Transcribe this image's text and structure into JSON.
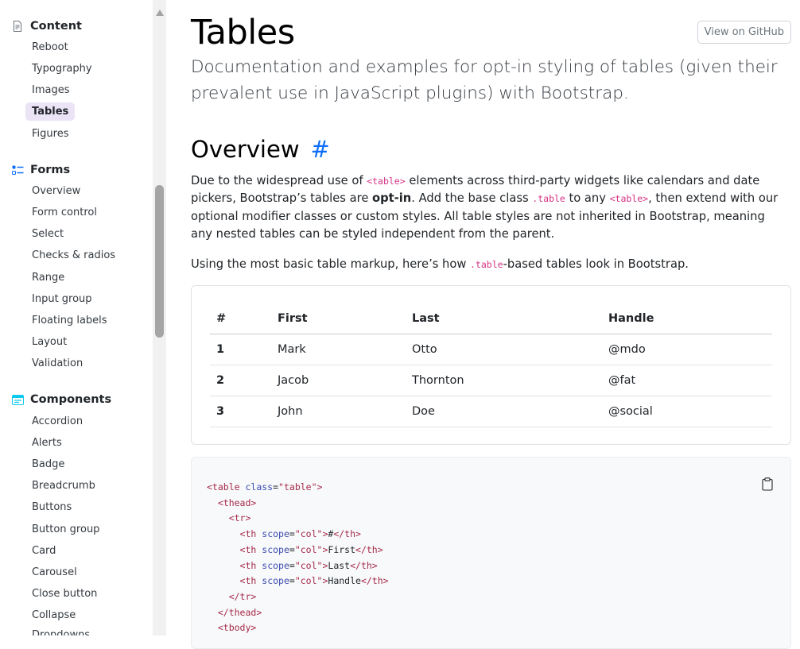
{
  "sidebar": {
    "groups": [
      {
        "title": "Content",
        "icon": "document-icon",
        "items": [
          "Reboot",
          "Typography",
          "Images",
          "Tables",
          "Figures"
        ],
        "active": "Tables"
      },
      {
        "title": "Forms",
        "icon": "ui-checks-icon",
        "items": [
          "Overview",
          "Form control",
          "Select",
          "Checks & radios",
          "Range",
          "Input group",
          "Floating labels",
          "Layout",
          "Validation"
        ]
      },
      {
        "title": "Components",
        "icon": "menu-button-icon",
        "items": [
          "Accordion",
          "Alerts",
          "Badge",
          "Breadcrumb",
          "Buttons",
          "Button group",
          "Card",
          "Carousel",
          "Close button",
          "Collapse",
          "Dropdowns"
        ]
      }
    ]
  },
  "page": {
    "title": "Tables",
    "github_button": "View on GitHub",
    "lead": "Documentation and examples for opt-in styling of tables (given their prevalent use in JavaScript plugins) with Bootstrap.",
    "overview": {
      "heading": "Overview",
      "anchor": "#",
      "p1": {
        "t1": "Due to the widespread use of ",
        "c1": "<table>",
        "t2": " elements across third-party widgets like calendars and date pickers, Bootstrap’s tables are ",
        "b1": "opt-in",
        "t3": ". Add the base class ",
        "c2": ".table",
        "t4": " to any ",
        "c3": "<table>",
        "t5": ", then extend with our optional modifier classes or custom styles. All table styles are not inherited in Bootstrap, meaning any nested tables can be styled independent from the parent."
      },
      "p2": {
        "t1": "Using the most basic table markup, here’s how ",
        "c1": ".table",
        "t2": "-based tables look in Bootstrap."
      }
    }
  },
  "example_table": {
    "headers": [
      "#",
      "First",
      "Last",
      "Handle"
    ],
    "rows": [
      [
        "1",
        "Mark",
        "Otto",
        "@mdo"
      ],
      [
        "2",
        "Jacob",
        "Thornton",
        "@fat"
      ],
      [
        "3",
        "John",
        "Doe",
        "@social"
      ]
    ]
  },
  "code_lines": [
    [
      {
        "c": "tag",
        "t": "<table"
      },
      {
        "c": "",
        "t": " "
      },
      {
        "c": "attr",
        "t": "class"
      },
      {
        "c": "",
        "t": "="
      },
      {
        "c": "str",
        "t": "\"table\""
      },
      {
        "c": "tag",
        "t": ">"
      }
    ],
    [
      {
        "c": "",
        "t": "  "
      },
      {
        "c": "tag",
        "t": "<thead>"
      }
    ],
    [
      {
        "c": "",
        "t": "    "
      },
      {
        "c": "tag",
        "t": "<tr>"
      }
    ],
    [
      {
        "c": "",
        "t": "      "
      },
      {
        "c": "tag",
        "t": "<th"
      },
      {
        "c": "",
        "t": " "
      },
      {
        "c": "attr",
        "t": "scope"
      },
      {
        "c": "",
        "t": "="
      },
      {
        "c": "str",
        "t": "\"col\""
      },
      {
        "c": "tag",
        "t": ">"
      },
      {
        "c": "",
        "t": "#"
      },
      {
        "c": "tag",
        "t": "</th>"
      }
    ],
    [
      {
        "c": "",
        "t": "      "
      },
      {
        "c": "tag",
        "t": "<th"
      },
      {
        "c": "",
        "t": " "
      },
      {
        "c": "attr",
        "t": "scope"
      },
      {
        "c": "",
        "t": "="
      },
      {
        "c": "str",
        "t": "\"col\""
      },
      {
        "c": "tag",
        "t": ">"
      },
      {
        "c": "",
        "t": "First"
      },
      {
        "c": "tag",
        "t": "</th>"
      }
    ],
    [
      {
        "c": "",
        "t": "      "
      },
      {
        "c": "tag",
        "t": "<th"
      },
      {
        "c": "",
        "t": " "
      },
      {
        "c": "attr",
        "t": "scope"
      },
      {
        "c": "",
        "t": "="
      },
      {
        "c": "str",
        "t": "\"col\""
      },
      {
        "c": "tag",
        "t": ">"
      },
      {
        "c": "",
        "t": "Last"
      },
      {
        "c": "tag",
        "t": "</th>"
      }
    ],
    [
      {
        "c": "",
        "t": "      "
      },
      {
        "c": "tag",
        "t": "<th"
      },
      {
        "c": "",
        "t": " "
      },
      {
        "c": "attr",
        "t": "scope"
      },
      {
        "c": "",
        "t": "="
      },
      {
        "c": "str",
        "t": "\"col\""
      },
      {
        "c": "tag",
        "t": ">"
      },
      {
        "c": "",
        "t": "Handle"
      },
      {
        "c": "tag",
        "t": "</th>"
      }
    ],
    [
      {
        "c": "",
        "t": "    "
      },
      {
        "c": "tag",
        "t": "</tr>"
      }
    ],
    [
      {
        "c": "",
        "t": "  "
      },
      {
        "c": "tag",
        "t": "</thead>"
      }
    ],
    [
      {
        "c": "",
        "t": "  "
      },
      {
        "c": "tag",
        "t": "<tbody>"
      }
    ]
  ]
}
